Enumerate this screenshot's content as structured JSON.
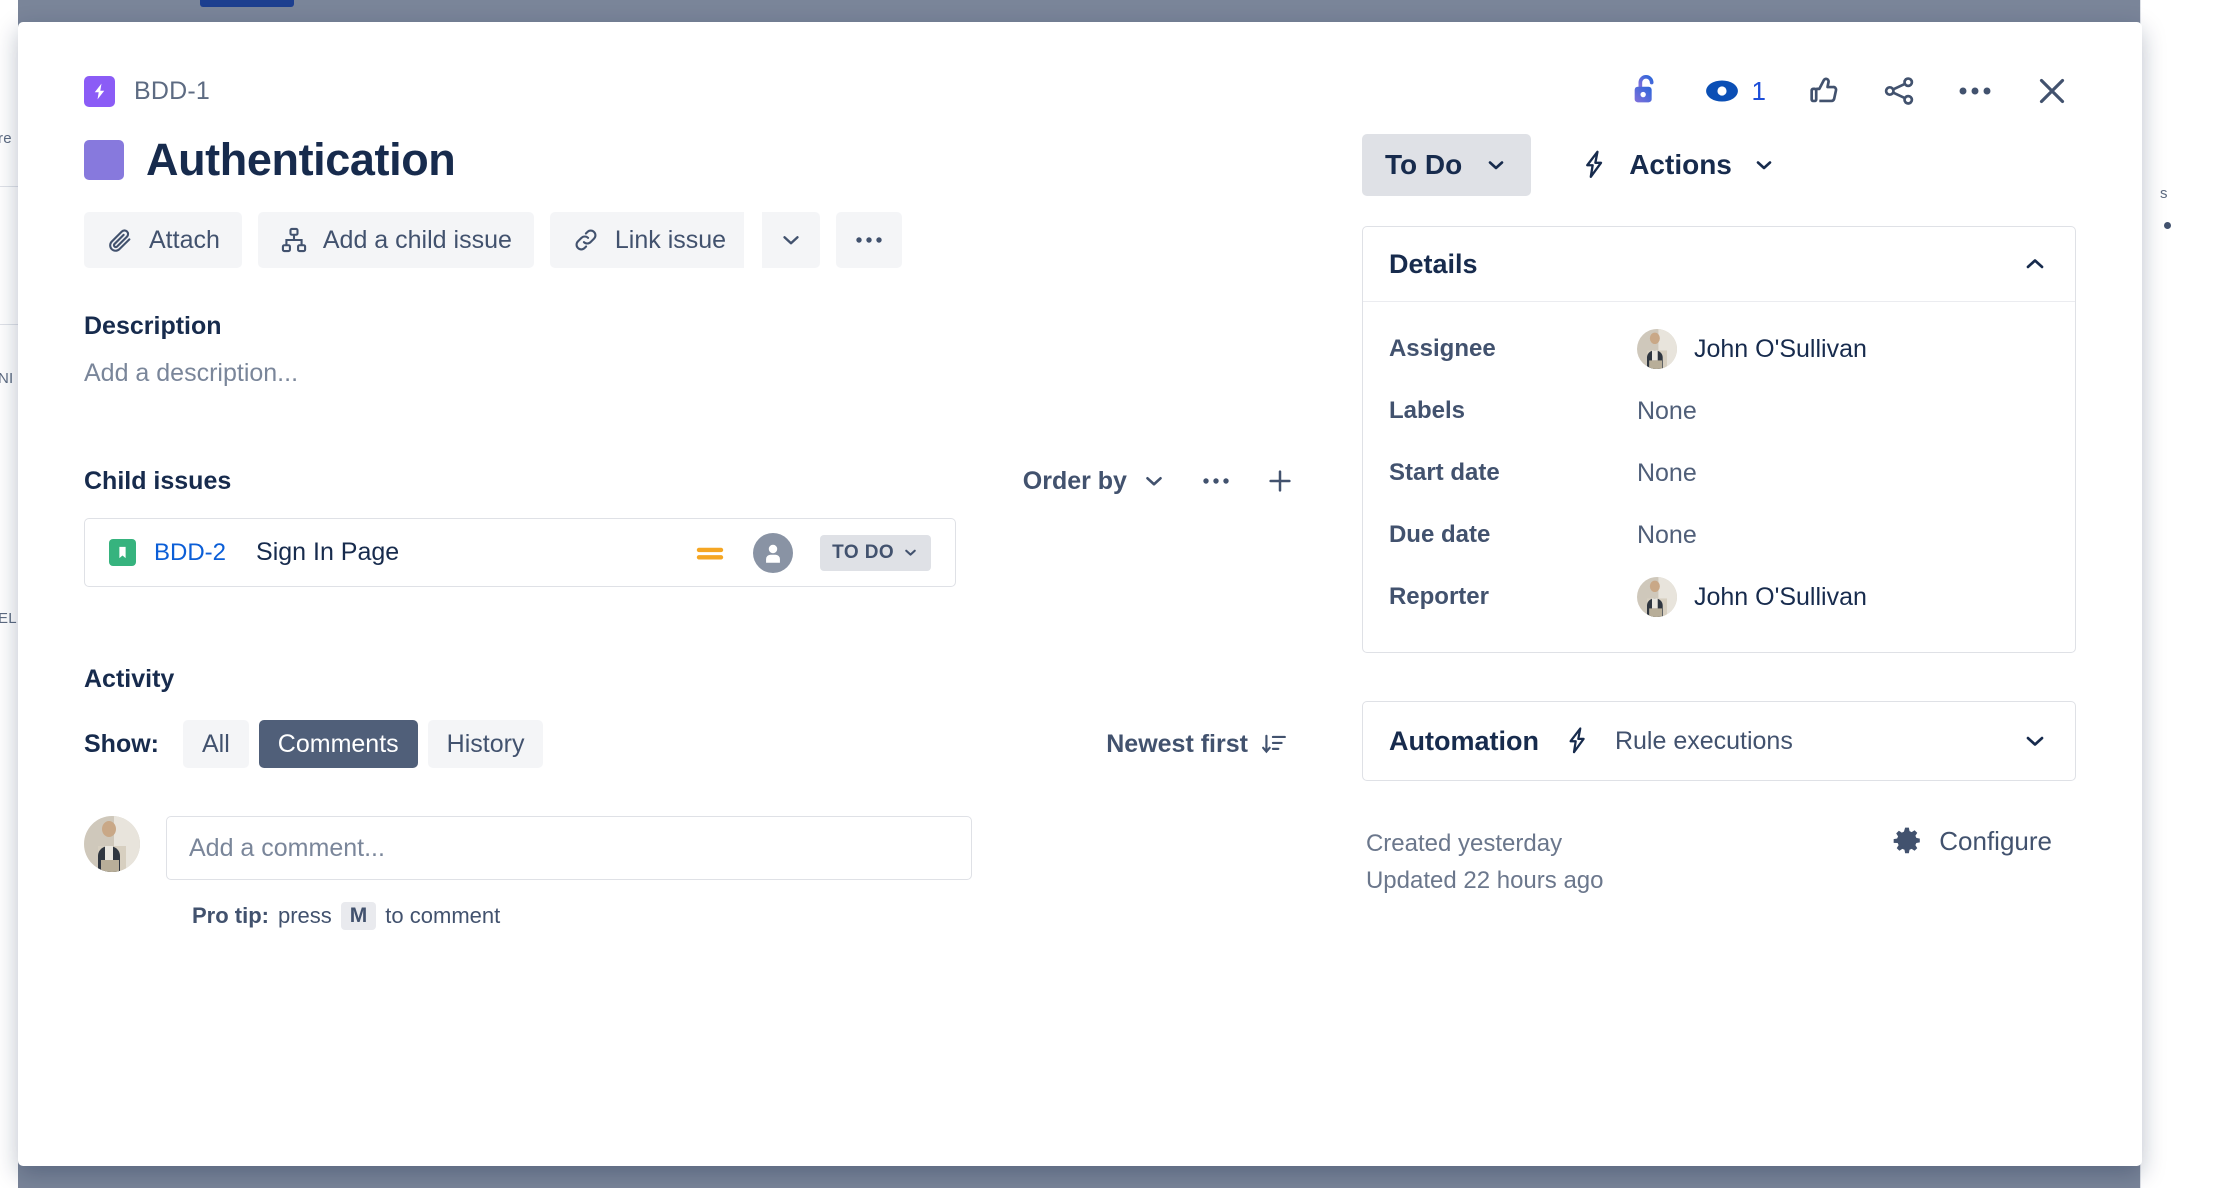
{
  "breadcrumb": {
    "key": "BDD-1",
    "icon": "epic-lightning-icon"
  },
  "top_actions": {
    "lock_icon": "unlock-icon",
    "watch_icon": "eye-watch-icon",
    "watch_count": "1",
    "like_icon": "thumbs-up-icon",
    "share_icon": "share-icon",
    "more_icon": "more-horizontal-icon",
    "close_icon": "close-icon"
  },
  "issue": {
    "title": "Authentication",
    "swatch_color": "#8779dd",
    "epic_color": "#8b5cf6"
  },
  "actions_bar": {
    "attach": "Attach",
    "add_child": "Add a child issue",
    "link_issue": "Link issue",
    "more": "…"
  },
  "description": {
    "heading": "Description",
    "placeholder": "Add a description..."
  },
  "child_issues": {
    "heading": "Child issues",
    "order_by": "Order by",
    "rows": [
      {
        "type_icon": "story-icon",
        "key": "BDD-2",
        "summary": "Sign In Page",
        "priority_icon": "priority-medium-icon",
        "assignee": "Unassigned",
        "status": "TO DO"
      }
    ]
  },
  "activity": {
    "heading": "Activity",
    "show_label": "Show:",
    "filters": [
      {
        "label": "All",
        "active": false
      },
      {
        "label": "Comments",
        "active": true
      },
      {
        "label": "History",
        "active": false
      }
    ],
    "sort": "Newest first",
    "comment_placeholder": "Add a comment...",
    "pro_tip_prefix": "Pro tip:",
    "pro_tip_press": "press",
    "pro_tip_key": "M",
    "pro_tip_suffix": "to comment"
  },
  "sidebar": {
    "status": "To Do",
    "actions": "Actions",
    "details": {
      "title": "Details",
      "fields": [
        {
          "label": "Assignee",
          "value": "John O'Sullivan",
          "type": "person"
        },
        {
          "label": "Labels",
          "value": "None",
          "type": "none"
        },
        {
          "label": "Start date",
          "value": "None",
          "type": "none"
        },
        {
          "label": "Due date",
          "value": "None",
          "type": "none"
        },
        {
          "label": "Reporter",
          "value": "John O'Sullivan",
          "type": "person"
        }
      ]
    },
    "automation": {
      "title": "Automation",
      "subtitle": "Rule executions"
    },
    "created": "Created yesterday",
    "updated": "Updated 22 hours ago",
    "configure": "Configure"
  },
  "background": {
    "left_fragments": [
      "re",
      "NI",
      "EL"
    ],
    "right_fragments": [
      "s"
    ]
  },
  "colors": {
    "accent_blue": "#0b5ed7",
    "epic_purple": "#8b5cf6",
    "story_green": "#36b37e",
    "priority_orange": "#f5a623",
    "text_dark": "#172b4d",
    "text_muted": "#6b778c",
    "overlay": "#7a8599"
  }
}
